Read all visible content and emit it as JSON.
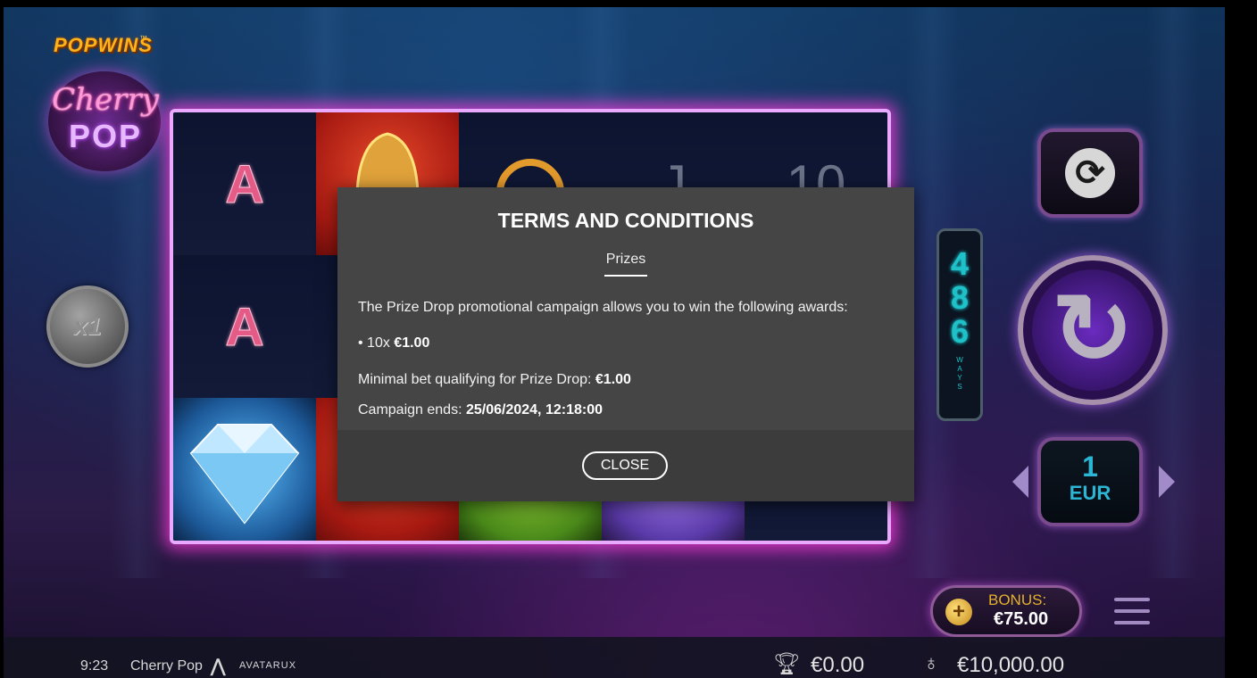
{
  "logo": {
    "brand": "POPWINS",
    "brand_tm": "™",
    "game_word1": "Cherry",
    "game_word2": "POP"
  },
  "reels": {
    "rows": [
      [
        "A",
        "bell",
        "Q",
        "J",
        "10"
      ],
      [
        "A",
        "",
        "",
        "",
        ""
      ],
      [
        "diamond",
        "",
        "",
        "",
        ""
      ]
    ]
  },
  "multiplier": {
    "label": "x1"
  },
  "ways": {
    "digits": [
      "4",
      "8",
      "6"
    ],
    "label": "WAYS"
  },
  "controls": {
    "autoplay_icon": "autoplay-arrows-icon",
    "spin_icon": "spin-arrow-icon",
    "bet": {
      "value": "1",
      "currency": "EUR"
    }
  },
  "bonus": {
    "label": "BONUS:",
    "amount": "€75.00"
  },
  "bottom_bar": {
    "clock": "9:23",
    "game_name": "Cherry Pop",
    "provider": "AVATARUX",
    "win": "€0.00",
    "balance": "€10,000.00"
  },
  "modal": {
    "title": "TERMS AND CONDITIONS",
    "tab": "Prizes",
    "intro": "The Prize Drop promotional campaign allows you to win the following awards:",
    "prize_count": "10x ",
    "prize_value": "€1.00",
    "min_bet_label": "Minimal bet qualifying for Prize Drop: ",
    "min_bet_value": "€1.00",
    "ends_label": "Campaign ends: ",
    "ends_value": "25/06/2024, 12:18:00",
    "close_label": "CLOSE"
  }
}
